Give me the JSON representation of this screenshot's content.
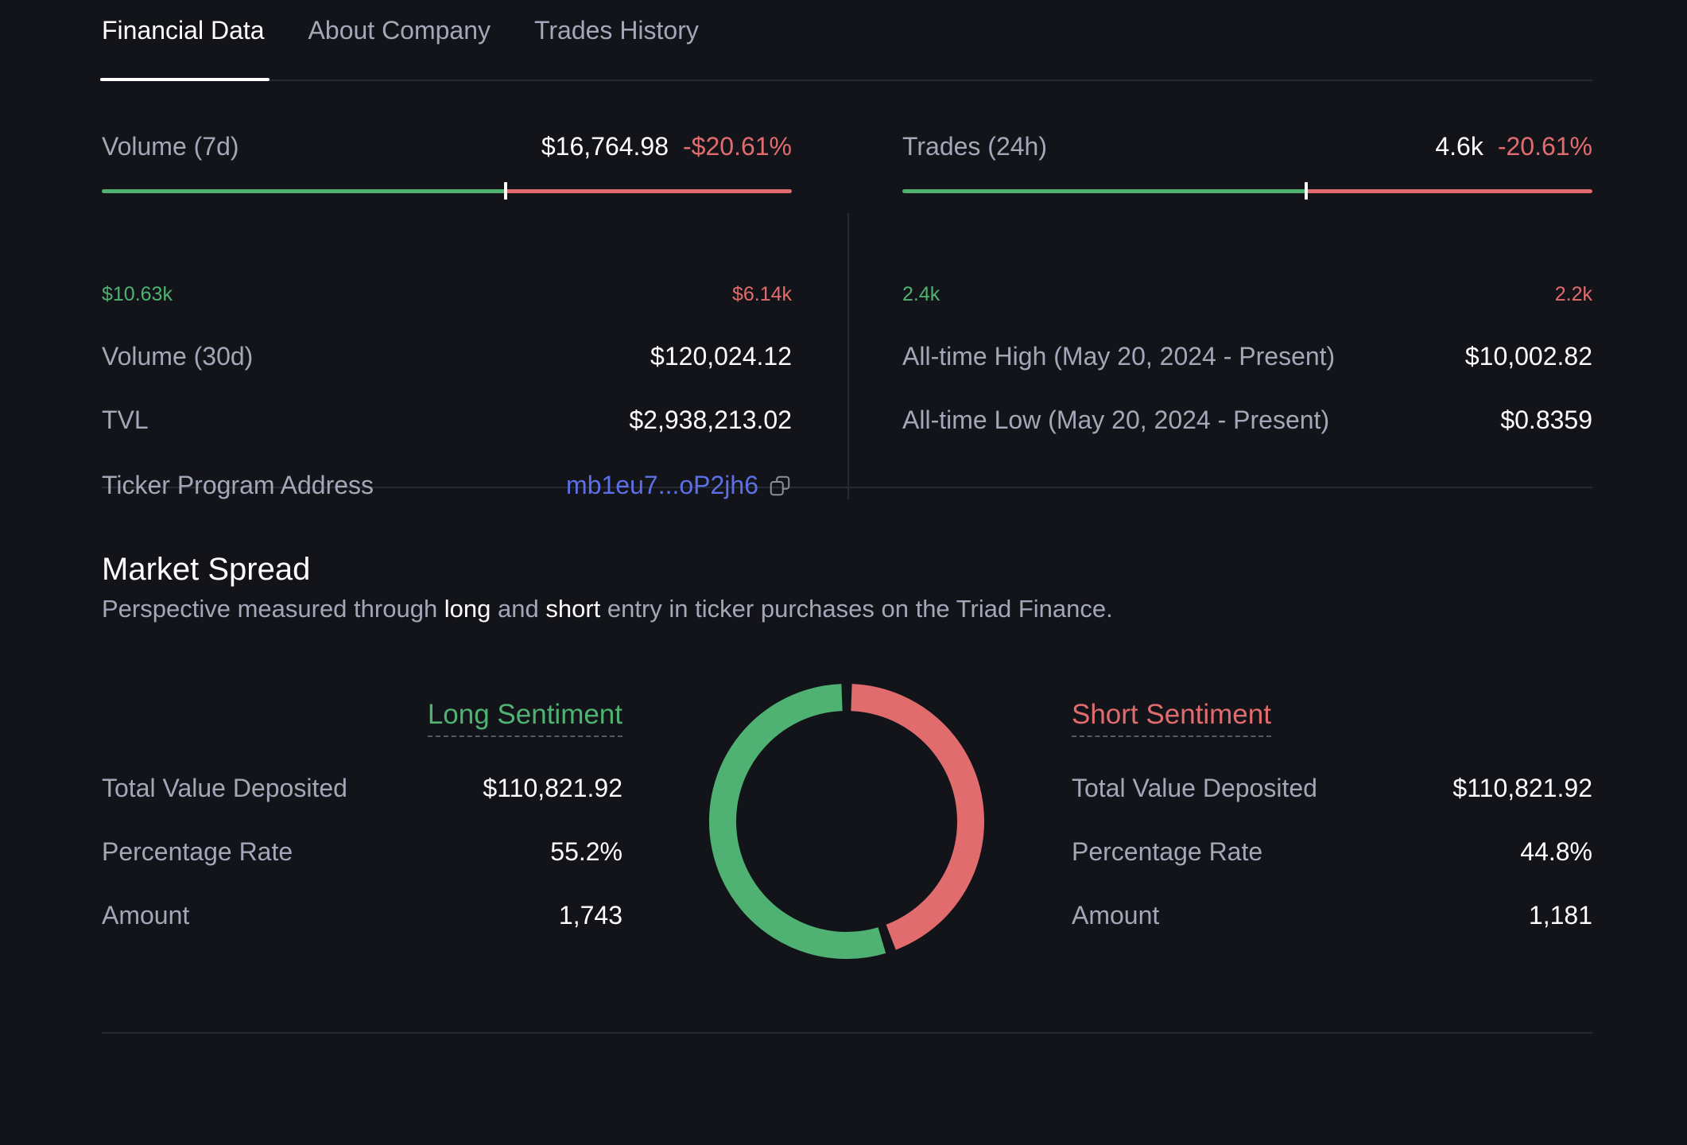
{
  "tabs": [
    {
      "label": "Financial Data",
      "active": true
    },
    {
      "label": "About Company",
      "active": false
    },
    {
      "label": "Trades History",
      "active": false
    }
  ],
  "left": {
    "volume7d": {
      "label": "Volume (7d)",
      "value": "$16,764.98",
      "change": "-$20.61%",
      "low": "$10.63k",
      "high": "$6.14k",
      "marker_fraction": 0.585
    },
    "volume30d": {
      "label": "Volume (30d)",
      "value": "$120,024.12"
    },
    "tvl": {
      "label": "TVL",
      "value": "$2,938,213.02"
    },
    "ticker": {
      "label": "Ticker Program Address",
      "value": "mb1eu7...oP2jh6"
    }
  },
  "right": {
    "trades24h": {
      "label": "Trades (24h)",
      "value": "4.6k",
      "change": "-20.61%",
      "low": "2.4k",
      "high": "2.2k",
      "marker_fraction": 0.585
    },
    "ath": {
      "label": "All-time High (May 20, 2024 - Present)",
      "value": "$10,002.82"
    },
    "atl": {
      "label": "All-time Low (May 20, 2024 - Present)",
      "value": "$0.8359"
    }
  },
  "spread": {
    "title": "Market Spread",
    "subtitle_pre": "Perspective measured through ",
    "subtitle_long": "long",
    "subtitle_and": " and ",
    "subtitle_short": "short",
    "subtitle_post": " entry in ticker purchases on the Triad Finance.",
    "long": {
      "heading": "Long Sentiment",
      "tvd_label": "Total Value Deposited",
      "tvd_value": "$110,821.92",
      "rate_label": "Percentage Rate",
      "rate_value": "55.2%",
      "amount_label": "Amount",
      "amount_value": "1,743"
    },
    "short": {
      "heading": "Short Sentiment",
      "tvd_label": "Total Value Deposited",
      "tvd_value": "$110,821.92",
      "rate_label": "Percentage Rate",
      "rate_value": "44.8%",
      "amount_label": "Amount",
      "amount_value": "1,181"
    },
    "donut": {
      "long_pct": 55.2,
      "short_pct": 44.8
    }
  },
  "colors": {
    "positive": "#4fb272",
    "negative": "#e06c6e",
    "link": "#5c6fe6",
    "background": "#131419"
  }
}
